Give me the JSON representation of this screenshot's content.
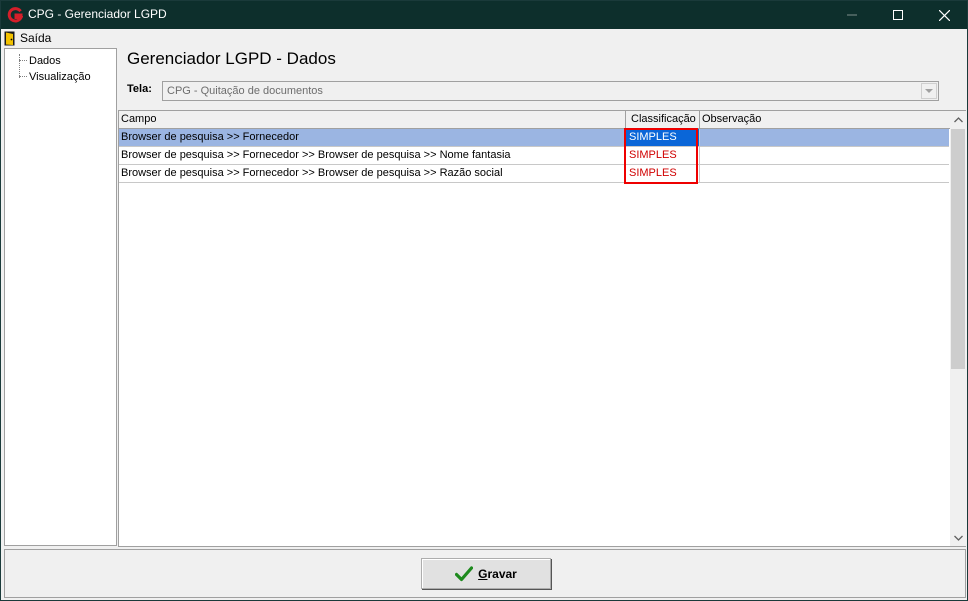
{
  "window": {
    "title": "CPG - Gerenciador LGPD",
    "brand_color": "#d41f2a",
    "titlebar_color": "#0d2f2c"
  },
  "menu": {
    "items": [
      {
        "label": "Saída",
        "icon": "door-exit-icon"
      }
    ]
  },
  "tree": {
    "items": [
      {
        "label": "Dados"
      },
      {
        "label": "Visualização"
      }
    ]
  },
  "main": {
    "heading": "Gerenciador LGPD - Dados",
    "tela_label": "Tela:",
    "tela_value": "CPG - Quitação de documentos"
  },
  "grid": {
    "columns": [
      "Campo",
      "Classificação",
      "Observação"
    ],
    "rows": [
      {
        "campo": "Browser de pesquisa >> Fornecedor",
        "classificacao": "SIMPLES",
        "observacao": "",
        "selected": true
      },
      {
        "campo": "Browser de pesquisa >> Fornecedor >> Browser de pesquisa >>  Nome fantasia",
        "classificacao": "SIMPLES",
        "observacao": "",
        "selected": false
      },
      {
        "campo": "Browser de pesquisa >> Fornecedor >> Browser de pesquisa >>  Razão social",
        "classificacao": "SIMPLES",
        "observacao": "",
        "selected": false
      }
    ],
    "selection_color": "#9bb5e2",
    "classification_color": "#d00000"
  },
  "footer": {
    "save_label_mnemonic": "G",
    "save_label_rest": "ravar",
    "save_icon": "checkmark-icon"
  }
}
